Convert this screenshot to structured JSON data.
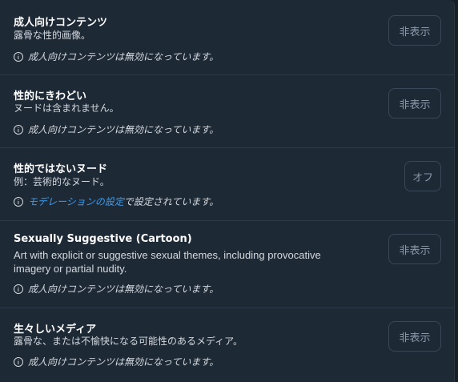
{
  "rows": [
    {
      "title": "成人向けコンテンツ",
      "description": "露骨な性的画像。",
      "note": "成人向けコンテンツは無効になっています。",
      "button": "非表示"
    },
    {
      "title": "性的にきわどい",
      "description": "ヌードは含まれません。",
      "note": "成人向けコンテンツは無効になっています。",
      "button": "非表示"
    },
    {
      "title": "性的ではないヌード",
      "description": "例：芸術的なヌード。",
      "note_link": "モデレーションの設定",
      "note_suffix": "で設定されています。",
      "button": "オフ"
    },
    {
      "title": "Sexually Suggestive (Cartoon)",
      "description_line1": "Art with explicit or suggestive sexual themes, including provocative",
      "description_line2": "imagery or partial nudity.",
      "note": "成人向けコンテンツは無効になっています。",
      "button": "非表示"
    },
    {
      "title": "生々しいメディア",
      "description": "露骨な、または不愉快になる可能性のあるメディア。",
      "note": "成人向けコンテンツは無効になっています。",
      "button": "非表示"
    }
  ]
}
